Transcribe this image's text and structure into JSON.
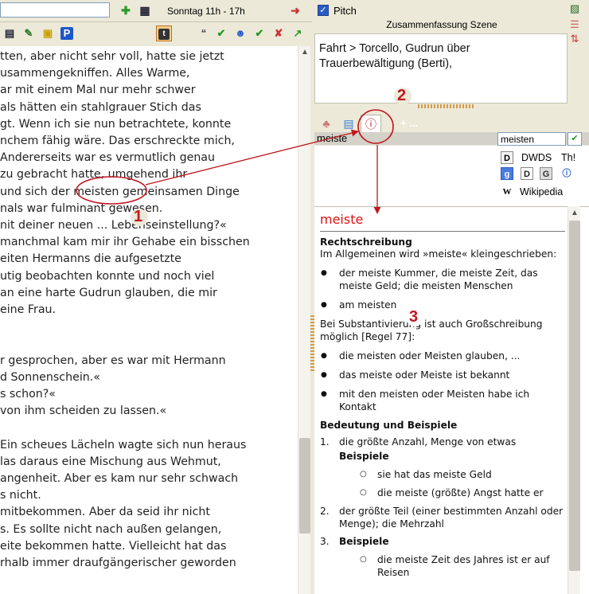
{
  "editor": {
    "time_label": "Sonntag 11h - 17h",
    "lines": [
      "tten, aber nicht sehr voll, hatte sie jetzt",
      "usammengekniffen. Alles Warme,",
      "ar mit einem Mal nur mehr schwer",
      " als hätten ein stahlgrauer Stich das",
      "gt. Wenn ich sie nun betrachtete, konnte",
      "nchem fähig wäre. Das erschreckte mich,",
      "Andererseits war es vermutlich genau",
      "zu gebracht hatte, umgehend ihr",
      " und sich der meisten gemeinsamen Dinge",
      "nals war fulminant gewesen.",
      "nit deiner neuen ... Lebenseinstellung?«",
      "manchmal kam mir ihr Gehabe ein bisschen",
      "eiten Hermanns die aufgesetzte",
      "utig beobachten konnte und noch viel",
      " an eine harte Gudrun glauben, die mir",
      "eine Frau.",
      "",
      "",
      "r gesprochen, aber es war mit Hermann",
      "d Sonnenschein.«",
      "s schon?«",
      " von ihm scheiden zu lassen.«",
      "",
      "Ein scheues Lächeln wagte sich nun heraus",
      " las daraus eine Mischung aus Wehmut,",
      "angenheit. Aber es kam nur sehr schwach",
      "s nicht.",
      " mitbekommen. Aber da seid ihr nicht",
      "s. Es sollte nicht nach außen gelangen,",
      "eite bekommen hatte. Vielleicht hat das",
      "rhalb immer draufgängerischer geworden"
    ]
  },
  "pitch": {
    "checkbox_glyph": "✓",
    "label": "Pitch",
    "summary_title": "Zusammenfassung Szene",
    "summary_text": "Fahrt > Torcello, Gudrun über Trauerbewältigung (Berti),"
  },
  "tabs": {
    "plus_label": "+ ..."
  },
  "lookup": {
    "search_term": "meiste",
    "search_input_value": "meisten",
    "sources": {
      "dwds": "DWDS",
      "th": "Th!",
      "wikipedia": "Wikipedia"
    }
  },
  "result": {
    "headword": "meiste",
    "section_orthography": "Rechtschreibung",
    "intro": "Im Allgemeinen wird »meiste« kleingeschrieben:",
    "bullets_a": [
      "der meiste Kummer, die meiste Zeit, das meiste Geld; die meisten Menschen",
      "am meisten"
    ],
    "subst_note": "Bei Substantivierung ist auch Großschreibung möglich [Regel 77]:",
    "bullets_b": [
      "die meisten oder Meisten glauben, ...",
      "das meiste oder Meiste ist bekannt",
      "mit den meisten oder Meisten habe ich Kontakt"
    ],
    "section_meaning": "Bedeutung und Beispiele",
    "n1_num": "1.",
    "n1_text": "die größte Anzahl, Menge von etwas",
    "beispiele": "Beispiele",
    "n1_examples": [
      "sie hat das meiste Geld",
      "die meiste (größte) Angst hatte er"
    ],
    "n2_num": "2.",
    "n2_text": "der größte Teil (einer bestimmten Anzahl oder Menge); die Mehrzahl",
    "n3_num": "3.",
    "n3_examples": [
      "die meiste Zeit des Jahres ist er auf Reisen"
    ]
  },
  "annotations": {
    "badge1": "1",
    "badge2": "2",
    "badge3": "3",
    "color": "#c0171f"
  },
  "colors": {
    "headword": "#dd1111",
    "panel_bg": "#ece9d8",
    "checkbox": "#2a5cc6"
  }
}
